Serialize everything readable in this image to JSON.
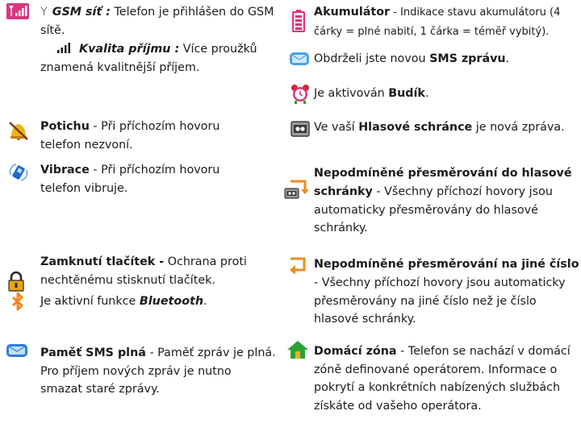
{
  "colors": {
    "text": "#1b1b1b",
    "icon_orange": "#f08a1c",
    "icon_blue": "#1f68c8",
    "icon_pink": "#e0337c",
    "icon_green": "#2aa335",
    "icon_yellow": "#e9b21a"
  },
  "left": {
    "gsm": {
      "icon": "network-signal-icon",
      "antenna": "Y",
      "title": "GSM síť :",
      "desc": "Telefon je přihlášen do GSM sítě.",
      "sub_icon": "signal-bars-icon",
      "sub_title": "Kvalita příjmu :",
      "sub_desc": "Více proužků znamená kvalitnější příjem."
    },
    "silent": {
      "icon": "silent-mode-icon",
      "title": "Potichu",
      "desc": " - Při příchozím hovoru telefon nezvoní."
    },
    "vibrate": {
      "icon": "vibrate-icon",
      "title": "Vibrace",
      "desc": " - Při příchozím hovoru telefon vibruje."
    },
    "keylock": {
      "icon": "padlock-icon",
      "title": "Zamknutí tlačítek -",
      "desc": " Ochrana proti nechtěnému stisknutí tlačítek."
    },
    "bluetooth": {
      "icon": "bluetooth-icon",
      "prefix": "Je aktivní funkce ",
      "title": "Bluetooth",
      "suffix": "."
    },
    "sms_full": {
      "icon": "sms-full-icon",
      "title": "Paměť SMS plná",
      "desc": " - Paměť zpráv je plná. Pro příjem nových zpráv je nutno smazat staré zprávy."
    }
  },
  "right": {
    "battery": {
      "icon": "battery-icon",
      "title": "Akumulátor",
      "desc": " - Indikace stavu akumulátoru (4 čárky = plné nabití, 1 čárka = téměř vybitý)."
    },
    "new_sms": {
      "icon": "envelope-icon",
      "prefix": "Obdrželi jste novou ",
      "title": "SMS zprávu",
      "suffix": "."
    },
    "alarm": {
      "icon": "alarm-clock-icon",
      "prefix": "Je aktivován ",
      "title": "Budík",
      "suffix": "."
    },
    "voicemail": {
      "icon": "voicemail-icon",
      "prefix": "Ve vaší ",
      "title": "Hlasové schránce",
      "suffix": " je nová zpráva."
    },
    "divert_vm": {
      "icon": "divert-voicemail-icon",
      "title": "Nepodmíněné přesměrování do hlasové schránky",
      "desc": " - Všechny příchozí hovory jsou automaticky přesměrovány do hlasové schránky."
    },
    "divert_num": {
      "icon": "divert-number-icon",
      "title": "Nepodmíněné přesměrování na jiné číslo",
      "desc": " - Všechny příchozí hovory jsou automaticky přesměrovány na jiné číslo než je číslo hlasové schránky."
    },
    "home_zone": {
      "icon": "home-zone-icon",
      "title": "Domácí zóna",
      "desc": " - Telefon se nachází v domácí zóně definované operátorem. Informace o pokrytí a konkrétních nabízených službách získáte od vašeho operátora."
    }
  }
}
